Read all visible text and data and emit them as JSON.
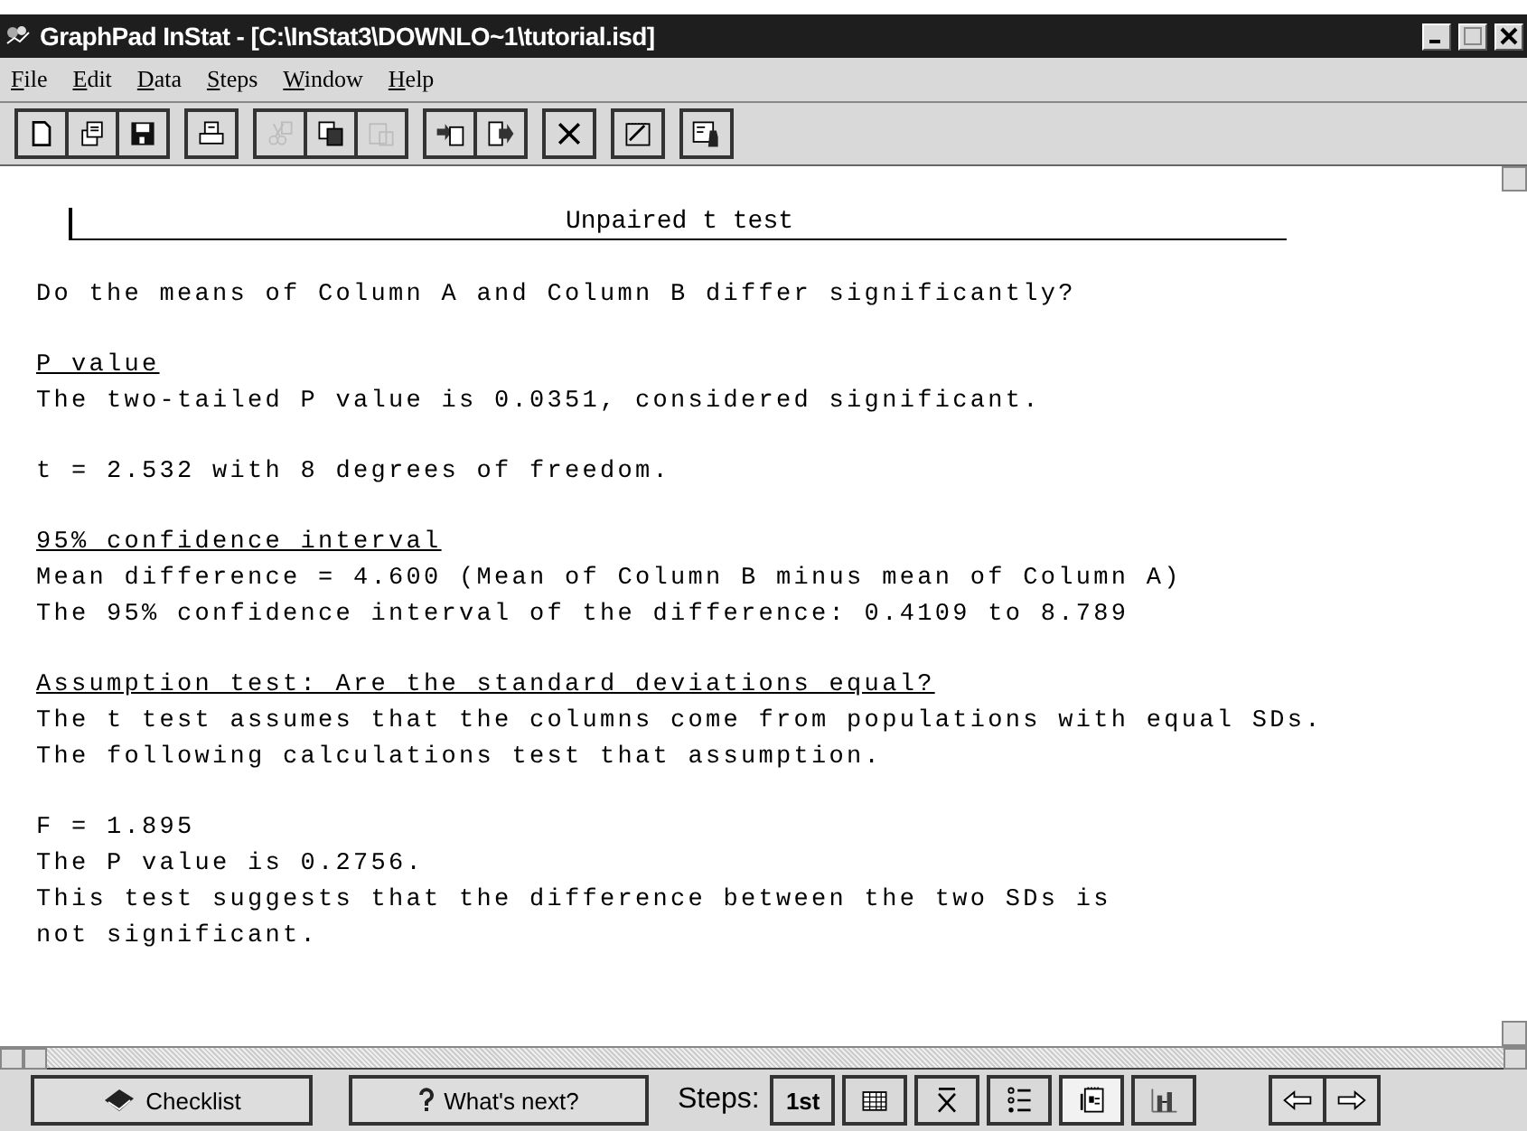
{
  "window": {
    "title": "GraphPad InStat - [C:\\InStat3\\DOWNLO~1\\tutorial.isd]"
  },
  "menu": [
    "File",
    "Edit",
    "Data",
    "Steps",
    "Window",
    "Help"
  ],
  "toolbar": [
    [
      {
        "kind": "new",
        "disabled": false
      },
      {
        "kind": "open",
        "disabled": false
      },
      {
        "kind": "save",
        "disabled": false
      }
    ],
    [
      {
        "kind": "print",
        "disabled": false
      }
    ],
    [
      {
        "kind": "cut",
        "disabled": true
      },
      {
        "kind": "copy",
        "disabled": false
      },
      {
        "kind": "paste",
        "disabled": true
      }
    ],
    [
      {
        "kind": "import",
        "disabled": false
      },
      {
        "kind": "export",
        "disabled": false
      }
    ],
    [
      {
        "kind": "close",
        "disabled": false
      }
    ],
    [
      {
        "kind": "notes",
        "disabled": false
      }
    ],
    [
      {
        "kind": "report",
        "disabled": false
      }
    ]
  ],
  "results": {
    "title": "Unpaired t test",
    "sections": [
      [
        {
          "kind": "plain",
          "text": "Do the means of Column A and Column B differ significantly?"
        }
      ],
      [
        {
          "kind": "heading",
          "text": "P value"
        },
        {
          "kind": "plain",
          "text": "The two-tailed P value is 0.0351, considered significant."
        }
      ],
      [
        {
          "kind": "plain",
          "text": "t = 2.532 with 8 degrees of freedom."
        }
      ],
      [
        {
          "kind": "heading",
          "text": "95% confidence interval"
        },
        {
          "kind": "plain",
          "text": "Mean difference = 4.600 (Mean of Column B minus mean of Column A)"
        },
        {
          "kind": "plain",
          "text": "The 95% confidence interval of the difference: 0.4109 to 8.789"
        }
      ],
      [
        {
          "kind": "heading",
          "text": "Assumption test: Are the standard deviations equal?"
        },
        {
          "kind": "plain",
          "text": "The t test assumes that the columns come from populations with equal SDs."
        },
        {
          "kind": "plain",
          "text": "The following calculations test that assumption."
        }
      ],
      [
        {
          "kind": "plain",
          "text": "F = 1.895"
        },
        {
          "kind": "plain",
          "text": "The P value is 0.2756."
        },
        {
          "kind": "plain",
          "text": "This test suggests that the difference between the two SDs is"
        },
        {
          "kind": "plain",
          "text": "not significant."
        }
      ]
    ]
  },
  "bottom_bar": {
    "checklist": "Checklist",
    "whats_next": "What's next?",
    "steps_label": "Steps:",
    "steps": [
      {
        "kind": "text",
        "label": "1st",
        "selected": false
      },
      {
        "kind": "grid",
        "selected": false
      },
      {
        "kind": "mean",
        "selected": false
      },
      {
        "kind": "list",
        "selected": false
      },
      {
        "kind": "pvalue",
        "selected": true
      },
      {
        "kind": "graph",
        "selected": false
      }
    ],
    "nav": [
      {
        "kind": "back"
      },
      {
        "kind": "forward"
      }
    ]
  }
}
